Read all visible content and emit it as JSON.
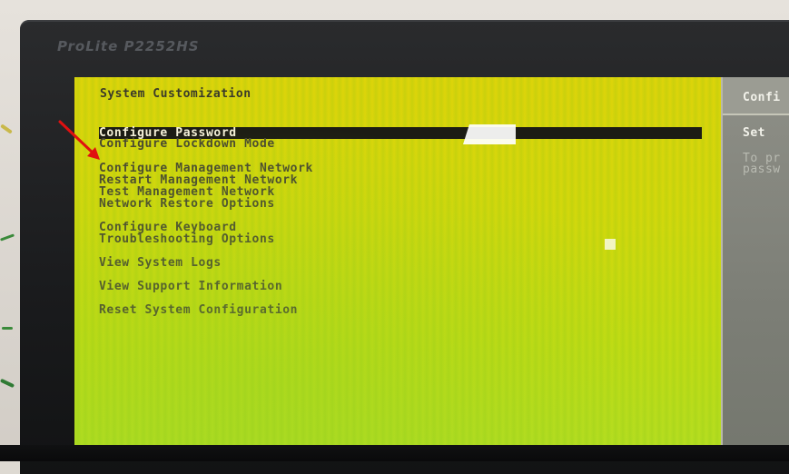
{
  "monitor": {
    "brand": "ProLite P2252HS"
  },
  "dcui": {
    "title": "System Customization",
    "menu": [
      {
        "label": "Configure Password",
        "selected": true
      },
      {
        "label": "Configure Lockdown Mode"
      },
      {
        "label": "Configure Management Network"
      },
      {
        "label": "Restart Management Network"
      },
      {
        "label": "Test Management Network"
      },
      {
        "label": "Network Restore Options"
      },
      {
        "label": "Configure Keyboard"
      },
      {
        "label": "Troubleshooting Options"
      },
      {
        "label": "View System Logs"
      },
      {
        "label": "View Support Information"
      },
      {
        "label": "Reset System Configuration"
      }
    ],
    "side_panel": {
      "header": "Confi",
      "line1": "Set",
      "desc1": "To pr",
      "desc2": "passw"
    }
  },
  "colors": {
    "screen_bg": "#d8d60c",
    "selection_bar": "#1c1c14",
    "side_panel": "#808279",
    "annotation_arrow": "#e01010"
  },
  "annotation": {
    "icon": "red-arrow-icon"
  }
}
